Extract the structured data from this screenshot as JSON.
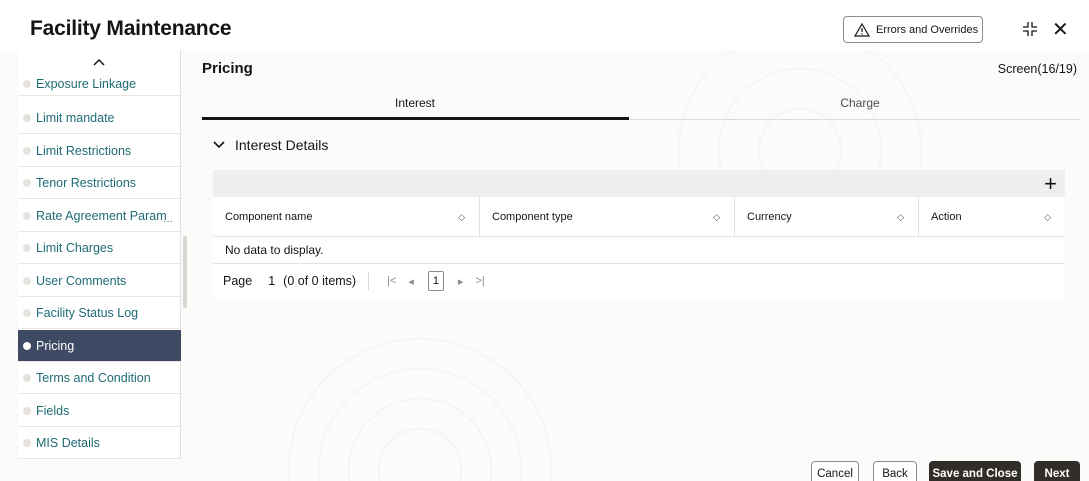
{
  "header": {
    "title": "Facility Maintenance",
    "errors_button": "Errors and Overrides"
  },
  "sidebar": {
    "items": [
      {
        "label": "Exposure Linkage",
        "active": false
      },
      {
        "label": "Limit mandate",
        "active": false
      },
      {
        "label": "Limit Restrictions",
        "active": false
      },
      {
        "label": "Tenor Restrictions",
        "active": false
      },
      {
        "label": "Rate Agreement Param",
        "active": false
      },
      {
        "label": "Limit Charges",
        "active": false
      },
      {
        "label": "User Comments",
        "active": false
      },
      {
        "label": "Facility Status Log",
        "active": false
      },
      {
        "label": "Pricing",
        "active": true
      },
      {
        "label": "Terms and Condition",
        "active": false
      },
      {
        "label": "Fields",
        "active": false
      },
      {
        "label": "MIS Details",
        "active": false
      }
    ],
    "up_arrow": "^"
  },
  "main": {
    "title": "Pricing",
    "screen_count": "Screen(16/19)",
    "tabs": [
      {
        "label": "Interest",
        "active": true
      },
      {
        "label": "Charge",
        "active": false
      }
    ],
    "section_title": "Interest Details",
    "table": {
      "columns": [
        "Component name",
        "Component type",
        "Currency",
        "Action"
      ],
      "empty_text": "No data to display."
    },
    "pager": {
      "page_label": "Page",
      "page_value": "1",
      "items_text": "(0 of 0 items)",
      "current_page": "1"
    }
  },
  "footer": {
    "cancel": "Cancel",
    "back": "Back",
    "save_close": "Save and Close",
    "next": "Next"
  },
  "colors": {
    "accent_dark": "#312d2a",
    "sidebar_active": "#3e4a63",
    "link_teal": "#1f6b75"
  }
}
